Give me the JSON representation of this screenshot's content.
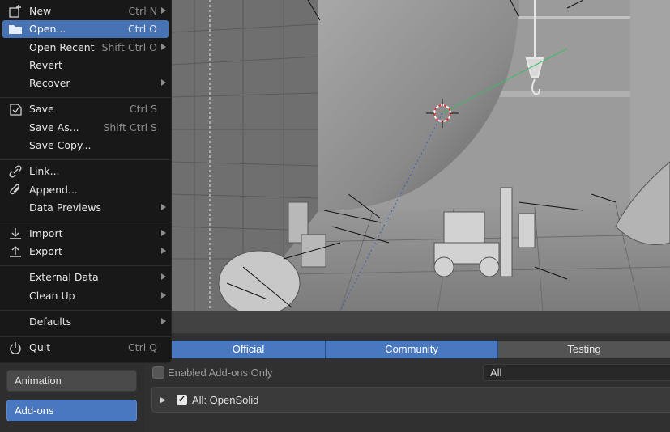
{
  "file_menu": {
    "items": [
      {
        "label": "New",
        "shortcut": "Ctrl N",
        "submenu": true,
        "icon": "new-file-icon"
      },
      {
        "label": "Open...",
        "shortcut": "Ctrl O",
        "submenu": false,
        "highlighted": true,
        "icon": "folder-icon"
      },
      {
        "label": "Open Recent",
        "shortcut": "Shift Ctrl O",
        "submenu": true
      },
      {
        "label": "Revert",
        "shortcut": "",
        "submenu": false
      },
      {
        "label": "Recover",
        "shortcut": "",
        "submenu": true
      },
      {
        "label": "Save",
        "shortcut": "Ctrl S",
        "submenu": false,
        "icon": "save-icon"
      },
      {
        "label": "Save As...",
        "shortcut": "Shift Ctrl S",
        "submenu": false
      },
      {
        "label": "Save Copy...",
        "shortcut": "",
        "submenu": false
      },
      {
        "label": "Link...",
        "shortcut": "",
        "submenu": false,
        "icon": "link-icon"
      },
      {
        "label": "Append...",
        "shortcut": "",
        "submenu": false,
        "icon": "paperclip-icon"
      },
      {
        "label": "Data Previews",
        "shortcut": "",
        "submenu": true
      },
      {
        "label": "Import",
        "shortcut": "",
        "submenu": true,
        "icon": "import-icon"
      },
      {
        "label": "Export",
        "shortcut": "",
        "submenu": true,
        "icon": "export-icon"
      },
      {
        "label": "External Data",
        "shortcut": "",
        "submenu": true
      },
      {
        "label": "Clean Up",
        "shortcut": "",
        "submenu": true
      },
      {
        "label": "Defaults",
        "shortcut": "",
        "submenu": true
      },
      {
        "label": "Quit",
        "shortcut": "Ctrl Q",
        "submenu": false,
        "icon": "power-icon"
      }
    ]
  },
  "preferences": {
    "categories": [
      {
        "label": "Animation",
        "active": false
      },
      {
        "label": "Add-ons",
        "active": true
      }
    ],
    "tabs": [
      {
        "label": "Official",
        "active": true
      },
      {
        "label": "Community",
        "active": true
      },
      {
        "label": "Testing",
        "active": false
      }
    ],
    "enabled_only_label": "Enabled Add-ons Only",
    "filter_value": "All",
    "addon_row_label": "All: OpenSolid"
  },
  "colors": {
    "menu_bg": "#181818",
    "highlight": "#4772b3",
    "tab_active": "#4a78c0",
    "viewport_bg": "#8d8d8d"
  }
}
